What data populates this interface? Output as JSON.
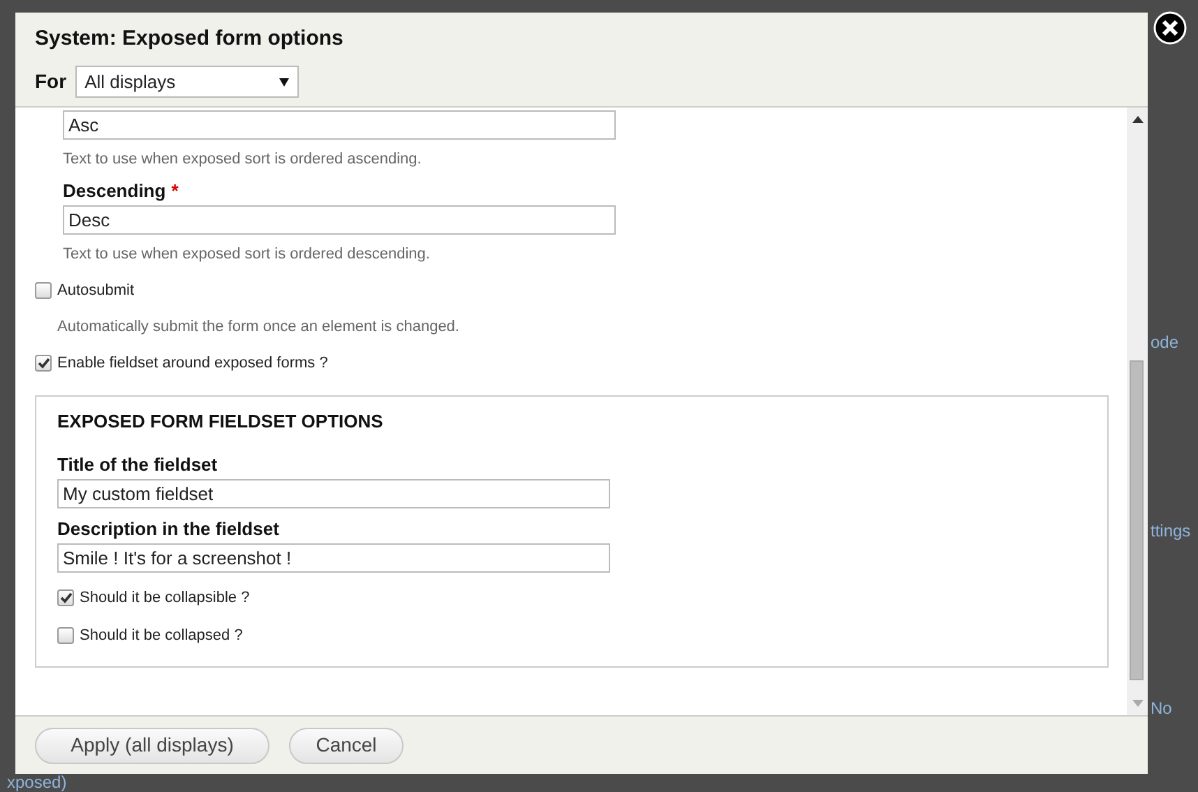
{
  "background_page": {
    "texts": [
      {
        "text": "ode",
        "kind": "link"
      },
      {
        "text": "ttings",
        "kind": "link"
      },
      {
        "text": "No",
        "kind": "link"
      },
      {
        "text": "xposed)",
        "kind": "link"
      }
    ]
  },
  "dialog": {
    "title": "System: Exposed form options",
    "display_select": {
      "label": "For",
      "value": "All displays"
    },
    "form": [
      {
        "kind": "text_field",
        "value": "Asc",
        "description": "Text to use when exposed sort is ordered ascending."
      },
      {
        "kind": "text_field",
        "label": "Descending",
        "required_marker": "*",
        "value": "Desc",
        "description": "Text to use when exposed sort is ordered descending."
      },
      {
        "kind": "checkbox",
        "label": "Autosubmit",
        "checked": false,
        "description": "Automatically submit the form once an element is changed."
      },
      {
        "kind": "checkbox",
        "label": "Enable fieldset around exposed forms ?",
        "checked": true
      },
      {
        "kind": "fieldset",
        "title": "EXPOSED FORM FIELDSET OPTIONS",
        "items": [
          {
            "kind": "text_field",
            "label": "Title of the fieldset",
            "value": "My custom fieldset"
          },
          {
            "kind": "text_field",
            "label": "Description in the fieldset",
            "value": "Smile ! It's for a screenshot !"
          },
          {
            "kind": "checkbox",
            "label": "Should it be collapsible ?",
            "checked": true
          },
          {
            "kind": "checkbox",
            "label": "Should it be collapsed ?",
            "checked": false
          }
        ]
      }
    ],
    "buttons": [
      "Apply (all displays)",
      "Cancel"
    ]
  }
}
